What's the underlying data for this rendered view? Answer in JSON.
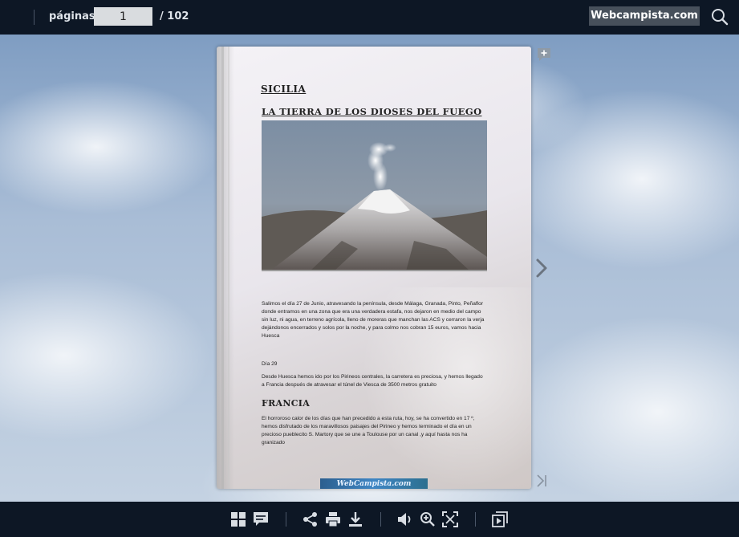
{
  "toolbar": {
    "pages_label": "páginas:",
    "current_page": "1",
    "total_pages": "/ 102",
    "site_button": "Webcampista.com"
  },
  "page": {
    "heading1": "SICILIA",
    "heading2": "LA TIERRA DE LOS DIOSES DEL FUEGO",
    "paragraph1": "Salimos el día 27 de Junio, atravesando la península, desde Málaga, Granada, Pinto, Peñaflor donde entramos en una zona que era una verdadera estafa, nos dejaron en medio del campo sin luz, ni agua, en terreno agrícola, lleno de moreras que manchan las ACS y cerraron la verja dejándonos encerrados y solos por la noche, y para colmo nos cobran 15 euros, vamos hacia Huesca",
    "day": "Día 29",
    "paragraph2": "Desde Huesca hemos ido por los Pirineos centrales, la carretera es preciosa, y hemos llegado a Francia después de atravesar el túnel de Viesca de 3500 metros gratuito",
    "heading3": "FRANCIA",
    "paragraph3": "El horroroso calor de los días que han precedido  a esta ruta, hoy, se ha convertido en 17 º, hemos disfrutado de los maravillosos paisajes del Pirineo y hemos terminado  el día en  un precioso pueblecito  S. Martory que se une a Toulouse por un canal ,y aquí hasta nos ha granizado",
    "footer_logo": "WebCampista.com"
  },
  "icons": {
    "search": "search-icon",
    "bookmark": "add-bookmark-icon",
    "next": "chevron-right-icon",
    "last": "last-page-icon",
    "bottom": [
      "thumbnails-icon",
      "notes-icon",
      "share-icon",
      "print-icon",
      "download-icon",
      "sound-icon",
      "zoom-in-icon",
      "fullscreen-icon",
      "slideshow-icon"
    ]
  },
  "colors": {
    "toolbar_bg": "#0d1725",
    "site_button_bg": "#47505b",
    "page_input_bg": "#d9dcdf"
  }
}
